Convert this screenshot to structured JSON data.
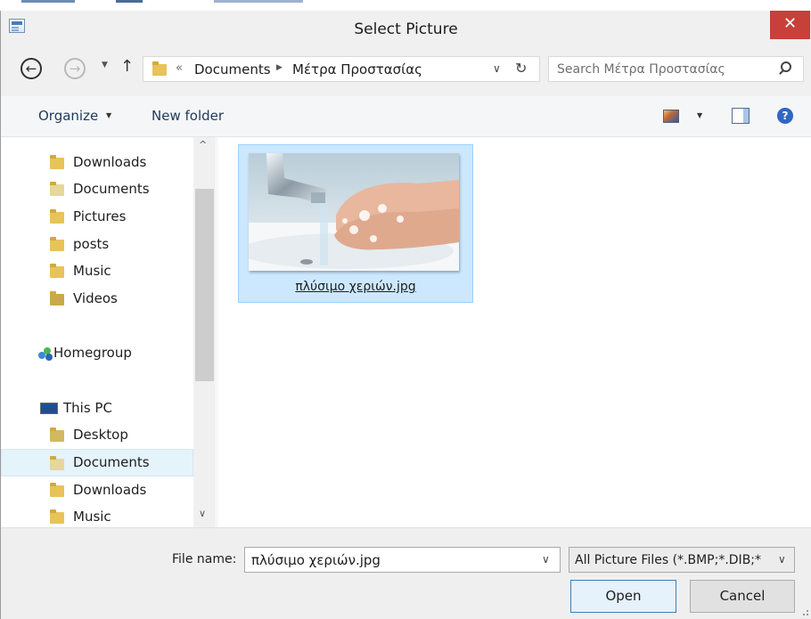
{
  "window": {
    "title": "Select Picture",
    "close_label": "✕"
  },
  "address_bar": {
    "back_glyph": "←",
    "forward_glyph": "→",
    "recent_glyph": "▼",
    "up_glyph": "↑",
    "overflow": "«",
    "crumbs": [
      "Documents",
      "Μέτρα Προστασίας"
    ],
    "crumb_separator": "▶",
    "dropdown_glyph": "∨",
    "refresh_glyph": "↻"
  },
  "search": {
    "placeholder": "Search Μέτρα Προστασίας"
  },
  "toolbar": {
    "organize_label": "Organize",
    "organize_caret": "▼",
    "new_folder_label": "New folder",
    "view_caret": "▼",
    "help_label": "?"
  },
  "nav_pane": {
    "scroll_up": "^",
    "scroll_down": "∨",
    "items": [
      {
        "label": "Downloads",
        "icon": "downloads-folder-icon"
      },
      {
        "label": "Documents",
        "icon": "documents-folder-icon"
      },
      {
        "label": "Pictures",
        "icon": "pictures-folder-icon"
      },
      {
        "label": "posts",
        "icon": "folder-icon"
      },
      {
        "label": "Music",
        "icon": "music-folder-icon"
      },
      {
        "label": "Videos",
        "icon": "videos-folder-icon"
      },
      {
        "label": "Homegroup",
        "icon": "homegroup-icon"
      },
      {
        "label": "This PC",
        "icon": "computer-icon"
      },
      {
        "label": "Desktop",
        "icon": "desktop-folder-icon"
      },
      {
        "label": "Documents",
        "icon": "documents-folder-icon",
        "selected": true
      },
      {
        "label": "Downloads",
        "icon": "downloads-folder-icon"
      },
      {
        "label": "Music",
        "icon": "music-folder-icon"
      }
    ]
  },
  "content": {
    "files": [
      {
        "name": "πλύσιμο χεριών.jpg",
        "selected": true
      }
    ]
  },
  "footer": {
    "file_name_label": "File name:",
    "file_name_value": "πλύσιμο χεριών.jpg",
    "file_name_caret": "∨",
    "filter_label": "All Picture Files (*.BMP;*.DIB;*",
    "filter_caret": "∨",
    "open_label": "Open",
    "cancel_label": "Cancel"
  },
  "colors": {
    "close_button": "#c7403a",
    "selection": "#cce8ff",
    "folder": "#e8c35a"
  }
}
